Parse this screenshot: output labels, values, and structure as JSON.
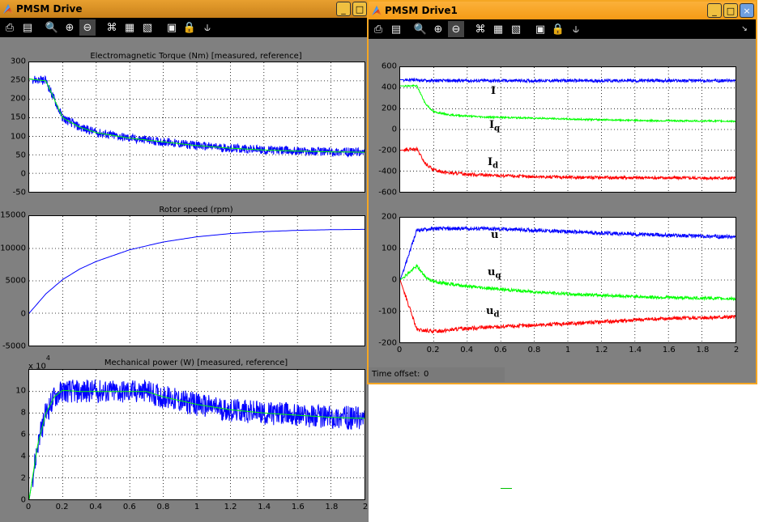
{
  "left_window": {
    "title": "PMSM  Drive",
    "buttons": [
      "_",
      "□",
      "×"
    ],
    "plots": [
      {
        "title": "Electromagnetic Torque (Nm)  [measured, reference]",
        "yticks": [
          "300",
          "250",
          "200",
          "150",
          "100",
          "50",
          "0",
          "-50"
        ],
        "ylim": [
          -50,
          300
        ],
        "xticks": []
      },
      {
        "title": "Rotor speed (rpm)",
        "yticks": [
          "15000",
          "10000",
          "5000",
          "0",
          "-5000"
        ],
        "ylim": [
          -5000,
          15000
        ],
        "xticks": []
      },
      {
        "title": "Mechanical power (W)  [measured, reference]",
        "exponent": "x 10",
        "exponent_power": "4",
        "yticks": [
          "10",
          "8",
          "6",
          "4",
          "2",
          "0"
        ],
        "ylim": [
          0,
          12
        ],
        "xticks": [
          "0",
          "0.2",
          "0.4",
          "0.6",
          "0.8",
          "1",
          "1.2",
          "1.4",
          "1.6",
          "1.8",
          "2"
        ]
      }
    ]
  },
  "right_window": {
    "title": "PMSM  Drive1",
    "buttons": [
      "_",
      "□",
      "×"
    ],
    "plots": [
      {
        "title": "",
        "yticks": [
          "600",
          "400",
          "200",
          "0",
          "-200",
          "-400",
          "-600"
        ],
        "ylim": [
          -600,
          600
        ],
        "xticks": [],
        "labels": [
          {
            "main": "I",
            "sub": ""
          },
          {
            "main": "I",
            "sub": "q"
          },
          {
            "main": "I",
            "sub": "d"
          }
        ]
      },
      {
        "title": "",
        "yticks": [
          "200",
          "100",
          "0",
          "-100",
          "-200"
        ],
        "ylim": [
          -200,
          200
        ],
        "xticks": [
          "0",
          "0.2",
          "0.4",
          "0.6",
          "0.8",
          "1",
          "1.2",
          "1.4",
          "1.6",
          "1.8",
          "2"
        ],
        "labels": [
          {
            "main": "u",
            "sub": ""
          },
          {
            "main": "u",
            "sub": "q"
          },
          {
            "main": "u",
            "sub": "d"
          }
        ]
      }
    ],
    "time_offset_label": "Time offset:",
    "time_offset_value": "0"
  },
  "chart_data": [
    {
      "type": "line",
      "title": "Electromagnetic Torque (Nm)  [measured, reference]",
      "xlim": [
        0,
        2
      ],
      "ylim": [
        -50,
        300
      ],
      "series": [
        {
          "name": "measured",
          "color": "#0000ff",
          "x": [
            0,
            0.1,
            0.2,
            0.3,
            0.4,
            0.6,
            0.8,
            1.0,
            1.2,
            1.4,
            1.6,
            1.8,
            2.0
          ],
          "y": [
            255,
            250,
            150,
            125,
            110,
            95,
            85,
            75,
            68,
            63,
            60,
            58,
            57
          ],
          "noise": 12
        },
        {
          "name": "reference",
          "color": "#00ff00",
          "x": [
            0,
            0.1,
            0.2,
            0.3,
            0.4,
            0.6,
            0.8,
            1.0,
            1.2,
            1.4,
            1.6,
            1.8,
            2.0
          ],
          "y": [
            255,
            250,
            150,
            125,
            110,
            95,
            85,
            75,
            68,
            63,
            60,
            58,
            57
          ],
          "noise": 0
        }
      ]
    },
    {
      "type": "line",
      "title": "Rotor speed (rpm)",
      "xlim": [
        0,
        2
      ],
      "ylim": [
        -5000,
        15000
      ],
      "series": [
        {
          "name": "",
          "color": "#0000ff",
          "x": [
            0,
            0.1,
            0.2,
            0.3,
            0.4,
            0.6,
            0.8,
            1.0,
            1.2,
            1.4,
            1.6,
            1.8,
            2.0
          ],
          "y": [
            0,
            3000,
            5200,
            6800,
            8000,
            9800,
            11000,
            11800,
            12300,
            12600,
            12800,
            12900,
            12950
          ],
          "noise": 0
        }
      ]
    },
    {
      "type": "line",
      "title": "Mechanical power (W)  [measured, reference]",
      "xlim": [
        0,
        2
      ],
      "ylim": [
        0,
        12
      ],
      "exponent": "x 10^4",
      "series": [
        {
          "name": "measured",
          "color": "#0000ff",
          "x": [
            0,
            0.05,
            0.1,
            0.15,
            0.2,
            0.3,
            0.5,
            0.7,
            0.8,
            1.0,
            1.2,
            1.4,
            1.6,
            1.8,
            2.0
          ],
          "y": [
            0,
            5,
            8,
            9.5,
            10.1,
            10,
            10,
            10,
            9.5,
            8.8,
            8.3,
            8.0,
            7.8,
            7.6,
            7.5
          ],
          "noise": 1.1
        },
        {
          "name": "reference",
          "color": "#00ff00",
          "x": [
            0,
            0.05,
            0.1,
            0.15,
            0.2,
            0.3,
            0.5,
            0.7,
            0.8,
            1.0,
            1.2,
            1.4,
            1.6,
            1.8,
            2.0
          ],
          "y": [
            0,
            5,
            8,
            9.5,
            10.1,
            10,
            10,
            10,
            9.5,
            8.8,
            8.3,
            8.0,
            7.8,
            7.6,
            7.5
          ],
          "noise": 0
        }
      ]
    },
    {
      "type": "line",
      "title": "",
      "xlim": [
        0,
        2
      ],
      "ylim": [
        -600,
        600
      ],
      "series": [
        {
          "name": "I",
          "color": "#0000ff",
          "x": [
            0,
            0.1,
            0.2,
            0.5,
            1.0,
            1.5,
            2.0
          ],
          "y": [
            480,
            475,
            470,
            470,
            470,
            470,
            470
          ],
          "noise": 15
        },
        {
          "name": "Iq",
          "color": "#00ff00",
          "x": [
            0,
            0.1,
            0.15,
            0.2,
            0.3,
            0.5,
            0.8,
            1.0,
            1.5,
            2.0
          ],
          "y": [
            420,
            420,
            250,
            170,
            140,
            120,
            110,
            100,
            85,
            80
          ],
          "noise": 8
        },
        {
          "name": "Id",
          "color": "#ff0000",
          "x": [
            0,
            0.1,
            0.15,
            0.2,
            0.3,
            0.5,
            0.8,
            1.0,
            1.5,
            2.0
          ],
          "y": [
            -200,
            -190,
            -330,
            -390,
            -420,
            -440,
            -455,
            -460,
            -465,
            -468
          ],
          "noise": 15
        }
      ]
    },
    {
      "type": "line",
      "title": "",
      "xlim": [
        0,
        2
      ],
      "ylim": [
        -200,
        200
      ],
      "series": [
        {
          "name": "u",
          "color": "#0000ff",
          "x": [
            0,
            0.1,
            0.2,
            0.5,
            0.8,
            1.0,
            1.5,
            2.0
          ],
          "y": [
            0,
            160,
            165,
            165,
            160,
            155,
            145,
            138
          ],
          "noise": 6
        },
        {
          "name": "uq",
          "color": "#00ff00",
          "x": [
            0,
            0.1,
            0.15,
            0.2,
            0.4,
            0.6,
            0.8,
            1.0,
            1.5,
            2.0
          ],
          "y": [
            0,
            45,
            10,
            -5,
            -20,
            -30,
            -38,
            -45,
            -55,
            -60
          ],
          "noise": 5
        },
        {
          "name": "ud",
          "color": "#ff0000",
          "x": [
            0,
            0.1,
            0.2,
            0.4,
            0.6,
            0.8,
            1.0,
            1.5,
            2.0
          ],
          "y": [
            0,
            -160,
            -165,
            -155,
            -150,
            -145,
            -140,
            -125,
            -118
          ],
          "noise": 6
        }
      ]
    }
  ]
}
